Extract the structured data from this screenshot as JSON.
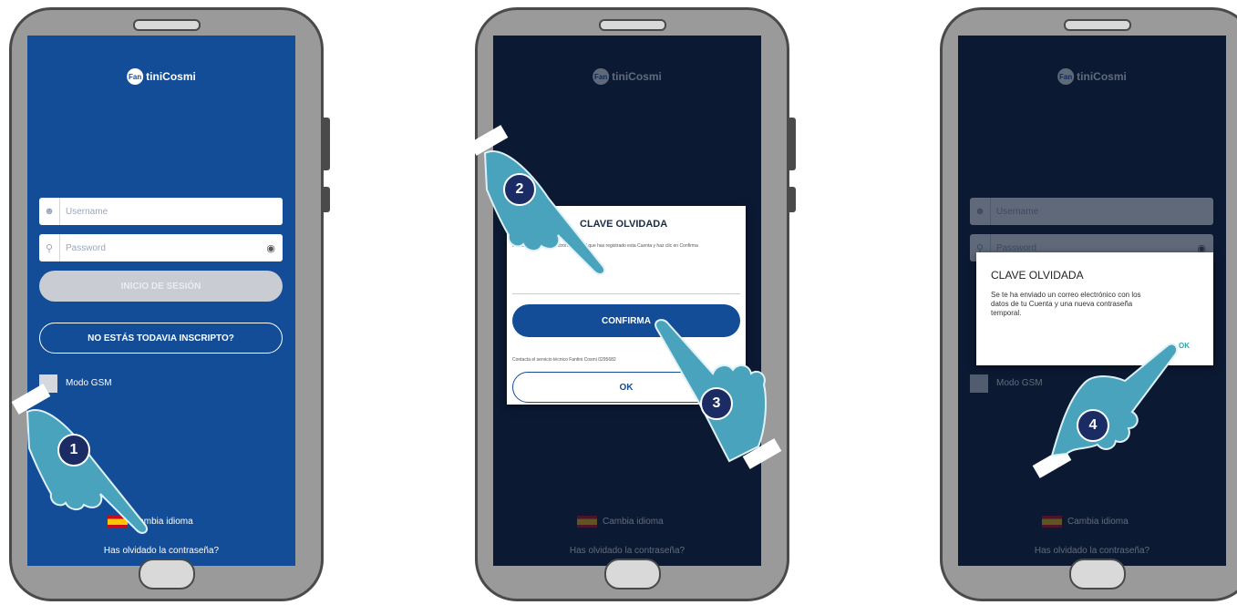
{
  "brand": {
    "logo_mark": "Fan",
    "logo_text": "tiniCosmi"
  },
  "login": {
    "username_placeholder": "Username",
    "password_placeholder": "Password",
    "login_button": "INICIO DE SESIÓN",
    "register_button": "NO ESTÁS TODAVIA INSCRIPTO?",
    "gsm_label": "Modo GSM",
    "language_label": "Cambia idioma",
    "forgot_link": "Has olvidado la contraseña?"
  },
  "forgot_dialog": {
    "title": "CLAVE OLVIDADA",
    "instruction": "Introduce el correo electrónico con el que has registrado esta Cuenta y haz clic en Confirma",
    "confirm_button": "CONFIRMA",
    "support_text": "Contacta el servicio técnico Fantini Cosmi 0295682",
    "ok_button": "OK"
  },
  "sent_dialog": {
    "title": "CLAVE OLVIDADA",
    "message": "Se te ha enviado un correo electrónico con los datos de tu Cuenta y una nueva contraseña temporal.",
    "ok_button": "OK"
  },
  "steps": [
    "1",
    "2",
    "3",
    "4"
  ],
  "colors": {
    "primary": "#134d97",
    "dark_overlay": "#0b1933",
    "hand": "#4aa3bd",
    "badge": "#1b2b63"
  },
  "icons": {
    "user": "user-icon",
    "lock": "lock-icon",
    "eye": "eye-icon",
    "hand": "pointing-hand-icon"
  }
}
